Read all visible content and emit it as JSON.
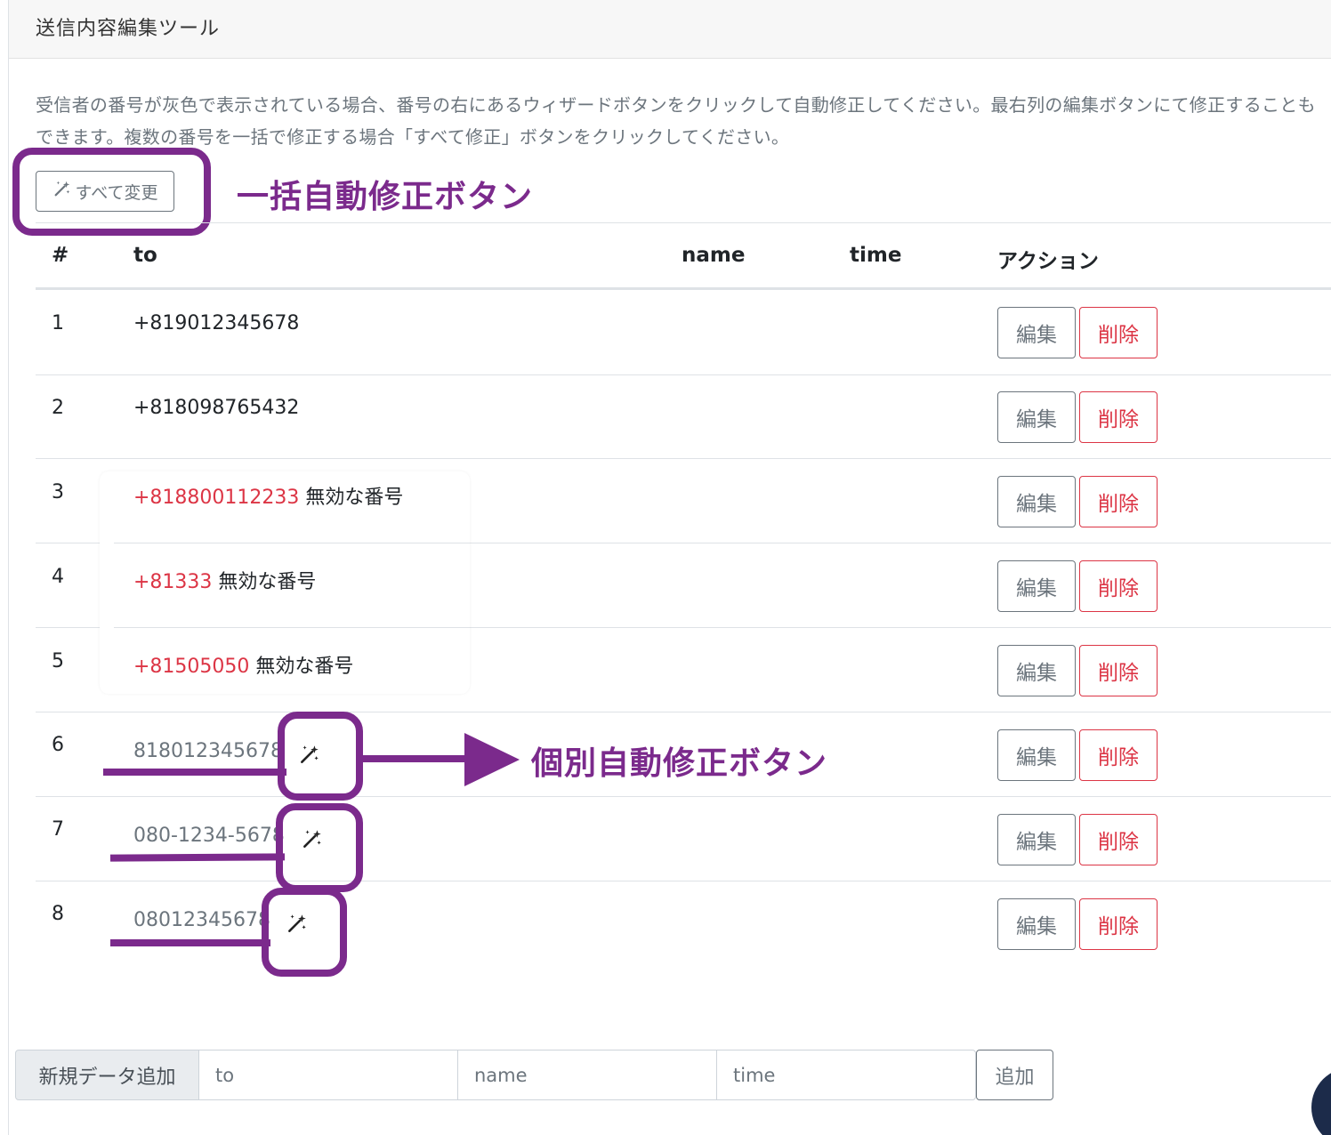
{
  "card": {
    "title": "送信内容編集ツール"
  },
  "description": "受信者の番号が灰色で表示されている場合、番号の右にあるウィザードボタンをクリックして自動修正してください。最右列の編集ボタンにて修正することもできます。複数の番号を一括で修正する場合「すべて修正」ボタンをクリックしてください。",
  "bulk_button": {
    "label": "すべて変更",
    "icon": "magic-wand-icon"
  },
  "annotations": {
    "bulk": "一括自動修正ボタン",
    "individual": "個別自動修正ボタン",
    "color": "#7b2a8c"
  },
  "table": {
    "headers": {
      "num": "#",
      "to": "to",
      "name": "name",
      "time": "time",
      "action": "アクション"
    },
    "edit_label": "編集",
    "delete_label": "削除",
    "rows": [
      {
        "num": "1",
        "to": "+819012345678",
        "status": "valid"
      },
      {
        "num": "2",
        "to": "+818098765432",
        "status": "valid"
      },
      {
        "num": "3",
        "to": "+818800112233",
        "status": "invalid",
        "note": "無効な番号"
      },
      {
        "num": "4",
        "to": "+81333",
        "status": "invalid",
        "note": "無効な番号"
      },
      {
        "num": "5",
        "to": "+81505050",
        "status": "invalid",
        "note": "無効な番号"
      },
      {
        "num": "6",
        "to": "818012345678",
        "status": "fixable"
      },
      {
        "num": "7",
        "to": "080-1234-5678",
        "status": "fixable"
      },
      {
        "num": "8",
        "to": "08012345678",
        "status": "fixable"
      }
    ]
  },
  "add_form": {
    "label": "新規データ追加",
    "to_placeholder": "to",
    "name_placeholder": "name",
    "time_placeholder": "time",
    "submit_label": "追加"
  },
  "colors": {
    "danger": "#dc3545",
    "secondary": "#6c757d",
    "annotation": "#7b2a8c"
  }
}
